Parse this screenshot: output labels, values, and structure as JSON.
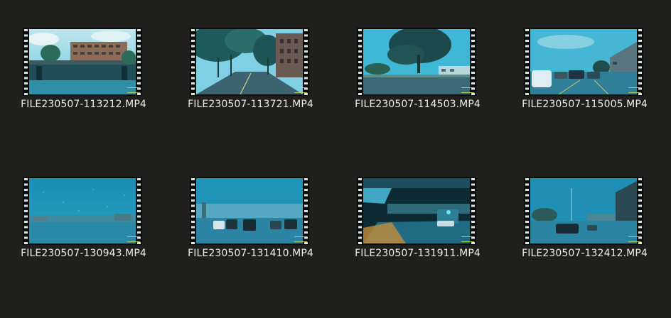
{
  "files": [
    {
      "name": "FILE230507-113212.MP4",
      "scene": "parking-building"
    },
    {
      "name": "FILE230507-113721.MP4",
      "scene": "tree-lined-road"
    },
    {
      "name": "FILE230507-114503.MP4",
      "scene": "big-tree-road"
    },
    {
      "name": "FILE230507-115005.MP4",
      "scene": "parking-lot"
    },
    {
      "name": "FILE230507-130943.MP4",
      "scene": "rain-open"
    },
    {
      "name": "FILE230507-131410.MP4",
      "scene": "rain-cars"
    },
    {
      "name": "FILE230507-131911.MP4",
      "scene": "garage"
    },
    {
      "name": "FILE230507-132412.MP4",
      "scene": "rain-street"
    }
  ],
  "colors": {
    "background": "#1f201e",
    "caption": "#ecece8",
    "sprocket": "#d9e4e4",
    "stamp": "#c8d24a"
  },
  "icons": {
    "thumbnail_overlay": "film-strip-icon"
  }
}
